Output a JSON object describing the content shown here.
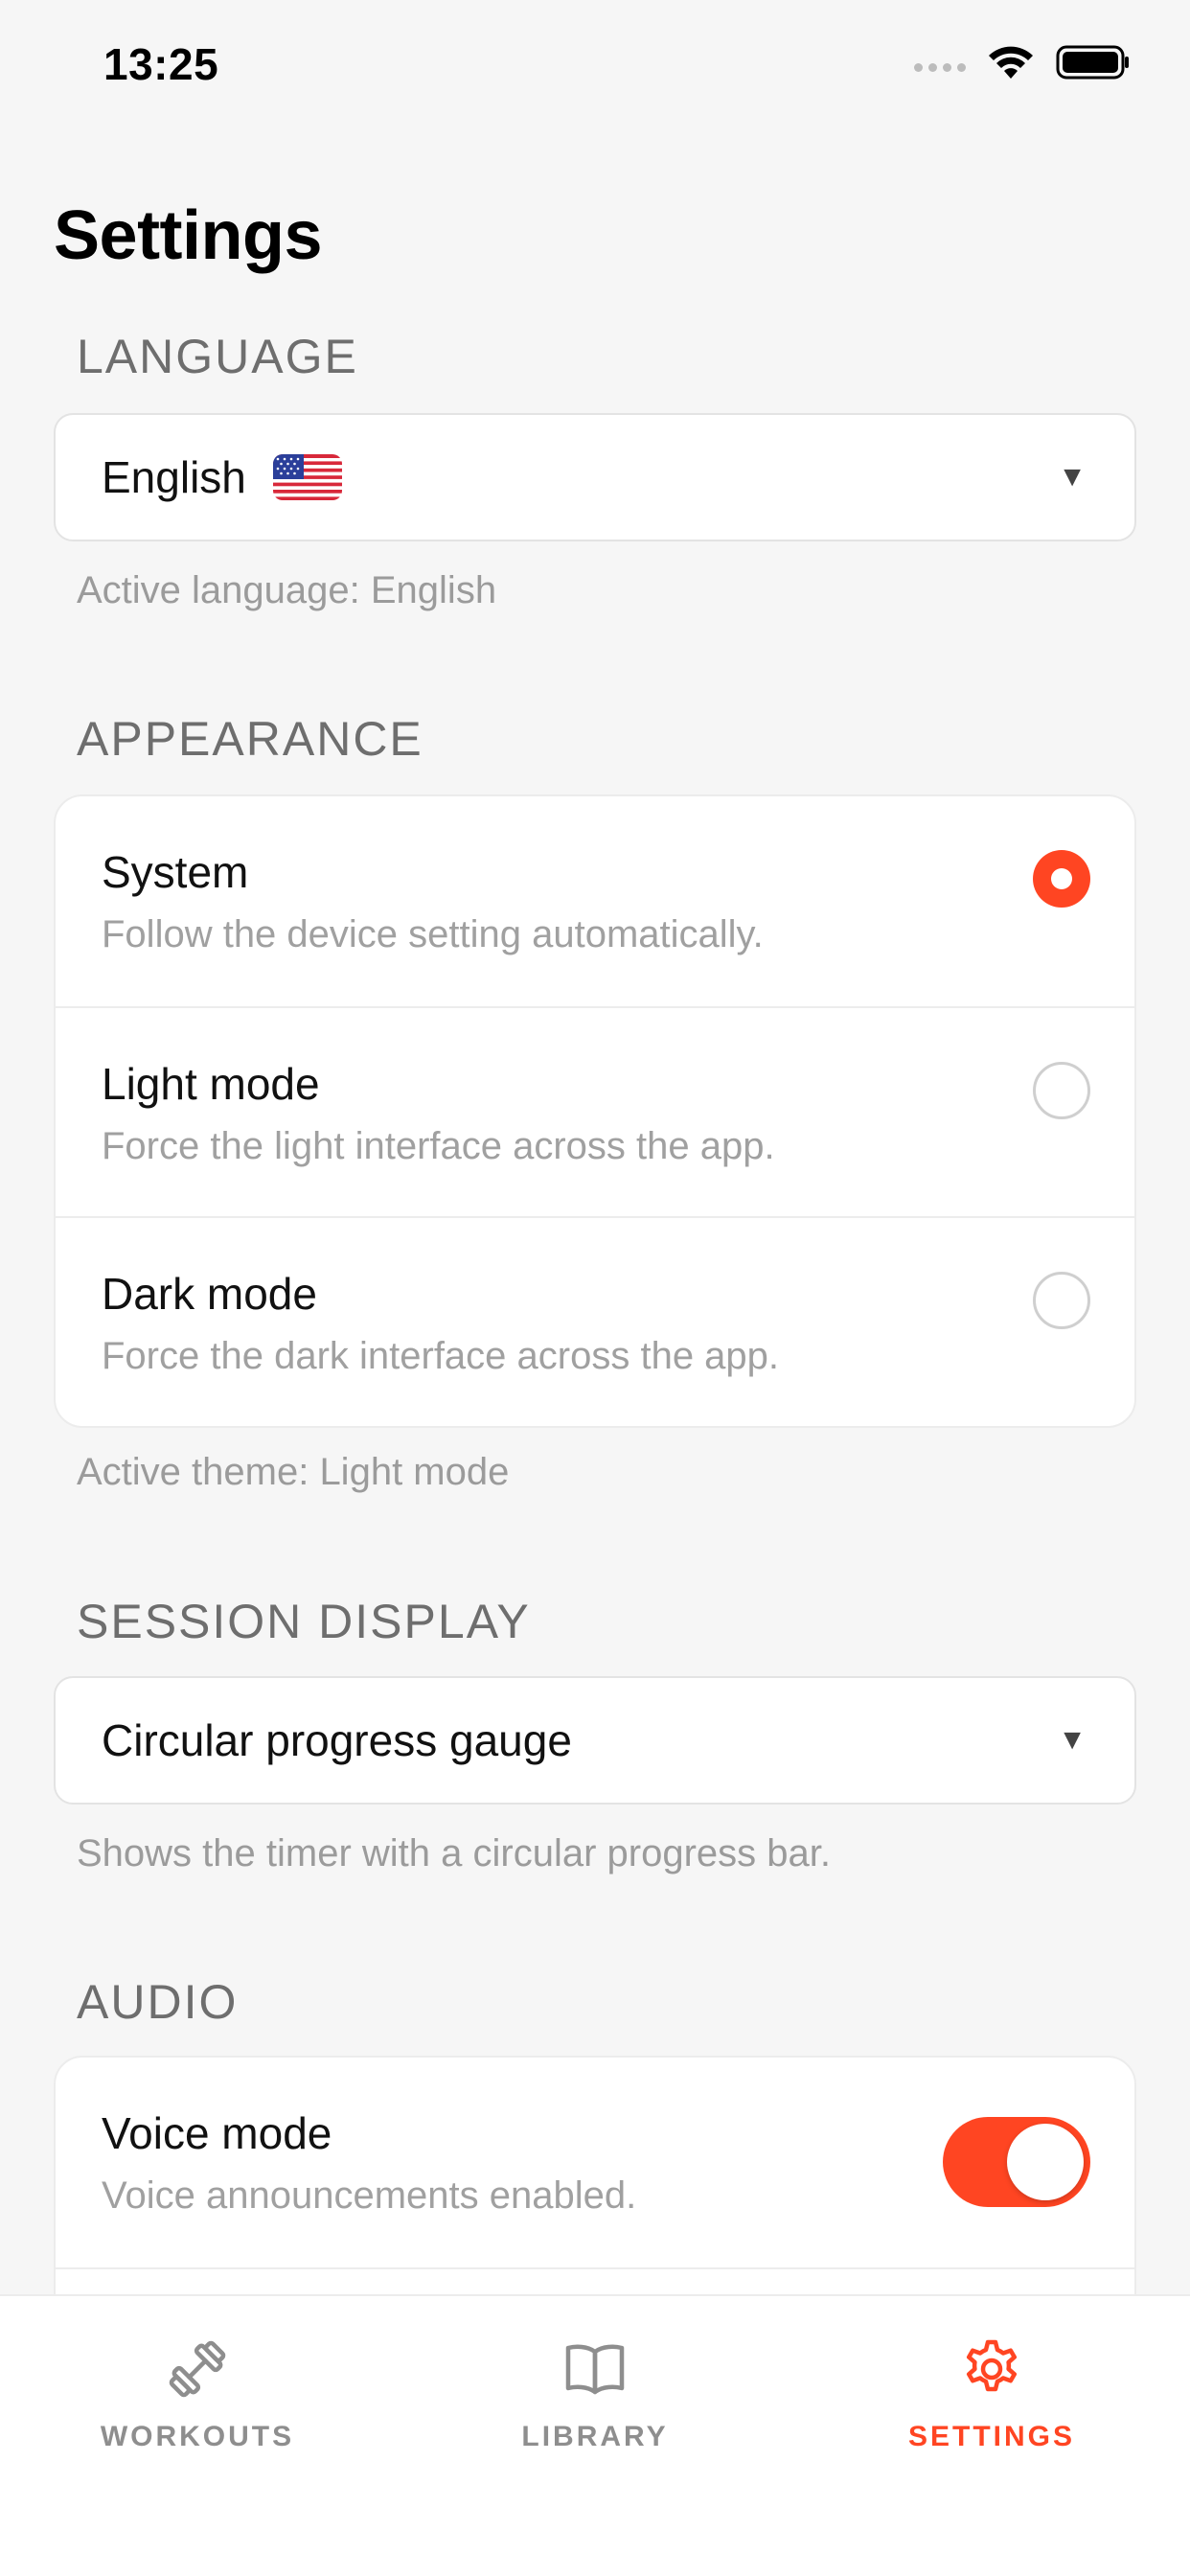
{
  "status_bar": {
    "time": "13:25"
  },
  "page": {
    "title": "Settings"
  },
  "language": {
    "header": "LANGUAGE",
    "selected": "English",
    "helper": "Active language: English"
  },
  "appearance": {
    "header": "APPEARANCE",
    "options": [
      {
        "title": "System",
        "description": "Follow the device setting automatically.",
        "selected": true
      },
      {
        "title": "Light mode",
        "description": "Force the light interface across the app.",
        "selected": false
      },
      {
        "title": "Dark mode",
        "description": "Force the dark interface across the app.",
        "selected": false
      }
    ],
    "helper": "Active theme: Light mode"
  },
  "session_display": {
    "header": "SESSION DISPLAY",
    "selected": "Circular progress gauge",
    "helper": "Shows the timer with a circular progress bar."
  },
  "audio": {
    "header": "AUDIO",
    "voice_mode": {
      "title": "Voice mode",
      "description": "Voice announcements enabled.",
      "enabled": true
    }
  },
  "tab_bar": {
    "tabs": [
      {
        "label": "WORKOUTS",
        "icon": "dumbbell-icon",
        "active": false
      },
      {
        "label": "LIBRARY",
        "icon": "book-icon",
        "active": false
      },
      {
        "label": "SETTINGS",
        "icon": "gear-icon",
        "active": true
      }
    ]
  },
  "colors": {
    "accent": "#ff4522",
    "background": "#f6f6f6"
  }
}
